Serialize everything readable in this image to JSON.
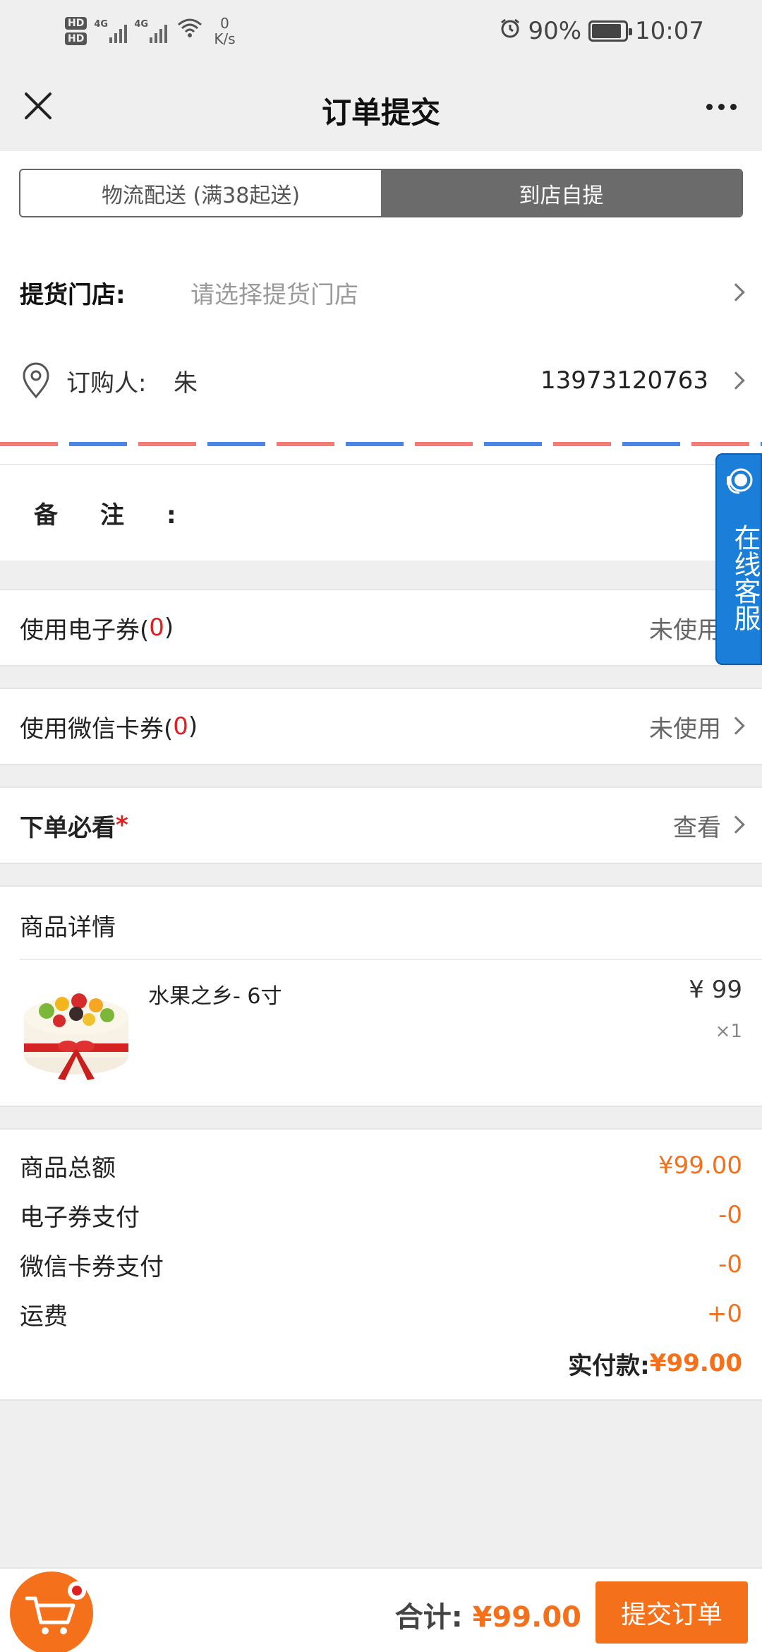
{
  "status_bar": {
    "hd1": "HD",
    "hd2": "HD",
    "net1": "4G",
    "net2": "4G",
    "speed_value": "0",
    "speed_unit": "K/s",
    "battery_percent": "90%",
    "battery_level": 0.9,
    "time": "10:07"
  },
  "header": {
    "title": "订单提交"
  },
  "delivery_tabs": [
    {
      "label": "物流配送 (满38起送)",
      "active": false
    },
    {
      "label": "到店自提",
      "active": true
    }
  ],
  "store": {
    "label": "提货门店:",
    "placeholder": "请选择提货门店"
  },
  "buyer": {
    "label": "订购人:",
    "name": "朱",
    "phone": "13973120763"
  },
  "remark": {
    "label": "备注",
    "colon": ":"
  },
  "options": {
    "ecoupon": {
      "label_pre": "使用电子券(",
      "count": "0",
      "label_post": ")",
      "value": "未使用"
    },
    "wxcard": {
      "label_pre": "使用微信卡券(",
      "count": "0",
      "label_post": ")",
      "value": "未使用"
    },
    "must_read": {
      "label": "下单必看",
      "required_mark": "*",
      "value": "查看"
    }
  },
  "product_section": {
    "title": "商品详情",
    "items": [
      {
        "name": "水果之乡- 6寸",
        "price": "¥ 99",
        "qty": "×1"
      }
    ]
  },
  "totals": {
    "goods_total_label": "商品总额",
    "goods_total": "¥99.00",
    "ecoupon_pay_label": "电子券支付",
    "ecoupon_pay": "-0",
    "wxcard_pay_label": "微信卡券支付",
    "wxcard_pay": "-0",
    "shipping_label": "运费",
    "shipping": "+0",
    "actual_label": "实付款:",
    "actual": "¥99.00"
  },
  "service_float": {
    "text": "在线客服"
  },
  "bottom_bar": {
    "sum_label": "合计:",
    "sum_value": "¥99.00",
    "submit_label": "提交订单"
  },
  "colors": {
    "accent": "#f5701a",
    "required": "#e02020",
    "service": "#1b7fd9",
    "tab_active": "#6b6b6b"
  }
}
